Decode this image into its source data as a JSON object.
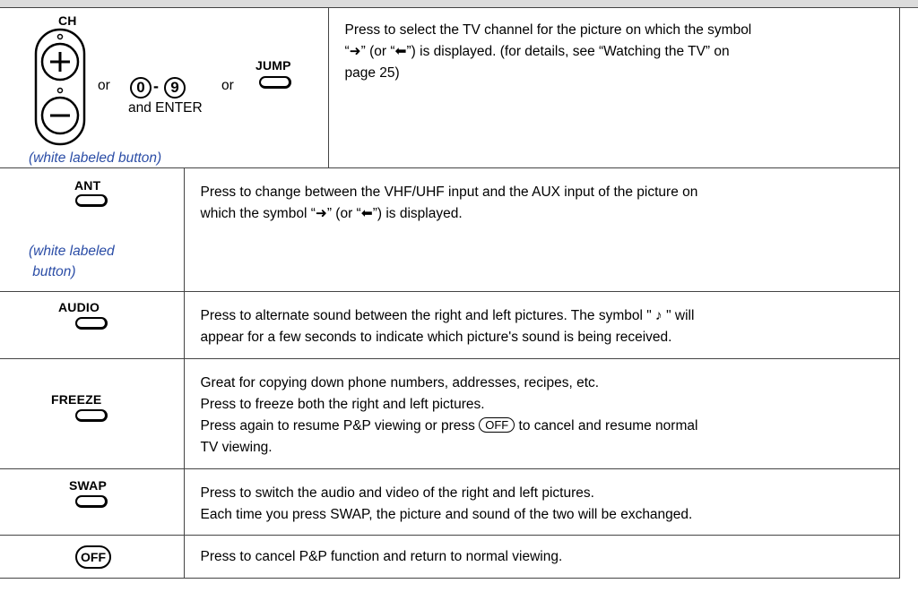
{
  "rows": [
    {
      "id": "ch",
      "control": {
        "ch_label": "CH",
        "plus_symbol": "+",
        "minus_symbol": "−",
        "or_1": "or",
        "digit_0": "0",
        "dash": "-",
        "digit_9": "9",
        "or_2": "or",
        "jump_label": "JUMP",
        "and_enter": "and ENTER"
      },
      "note": "(white labeled button)",
      "description": [
        "Press to select the TV channel for the picture on which the symbol",
        "“➜” (or “⬅”) is displayed.  (for details, see “Watching the TV” on",
        "page 25)"
      ]
    },
    {
      "id": "ant",
      "control": {
        "label": "ANT"
      },
      "note_lines": [
        "(white labeled",
        " button)"
      ],
      "description": [
        "Press to change between the VHF/UHF input and the AUX input of the picture on",
        "which the symbol “➜” (or “⬅”) is displayed."
      ]
    },
    {
      "id": "audio",
      "control": {
        "label": "AUDIO"
      },
      "description": [
        "Press to alternate sound between the right and left pictures. The symbol \" ♪ \"  will",
        "appear for a few seconds to indicate which picture's sound is being received."
      ]
    },
    {
      "id": "freeze",
      "control": {
        "label": "FREEZE"
      },
      "description": [
        "Great for copying down phone numbers, addresses, recipes, etc.",
        "Press to freeze both the right and left pictures."
      ],
      "line3_before": "Press again to resume P&P viewing or press ",
      "line3_key": "OFF",
      "line3_after": " to cancel and resume normal",
      "line4": "TV viewing."
    },
    {
      "id": "swap",
      "control": {
        "label": "SWAP"
      },
      "description": [
        "Press to switch the audio and video of the right and left pictures.",
        "Each time you press SWAP, the picture and sound of the two will be exchanged."
      ]
    },
    {
      "id": "off",
      "control": {
        "label": "OFF"
      },
      "description": [
        "Press to cancel P&P function and return to normal viewing."
      ]
    }
  ]
}
